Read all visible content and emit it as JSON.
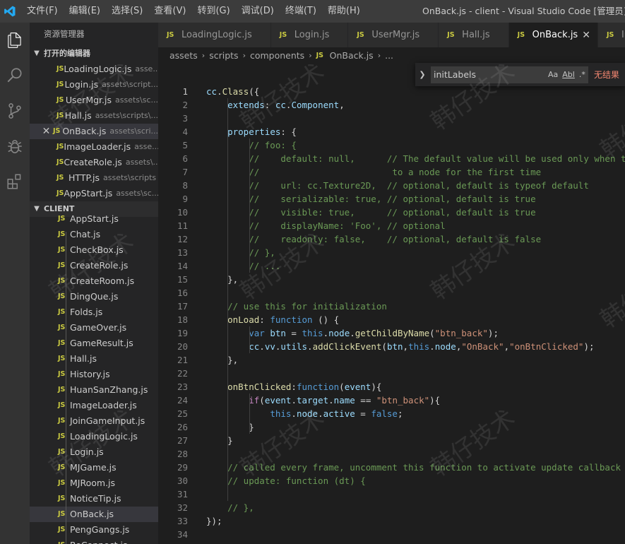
{
  "window": {
    "title": "OnBack.js - client - Visual Studio Code [管理员]",
    "menu": [
      "文件(F)",
      "编辑(E)",
      "选择(S)",
      "查看(V)",
      "转到(G)",
      "调试(D)",
      "终端(T)",
      "帮助(H)"
    ]
  },
  "sidebar": {
    "title": "资源管理器",
    "open_editors_label": "打开的编辑器",
    "open_editors": [
      {
        "name": "LoadingLogic.js",
        "path": "asse..."
      },
      {
        "name": "Login.js",
        "path": "assets\\script..."
      },
      {
        "name": "UserMgr.js",
        "path": "assets\\sc..."
      },
      {
        "name": "Hall.js",
        "path": "assets\\scripts\\..."
      },
      {
        "name": "OnBack.js",
        "path": "assets\\scri..."
      },
      {
        "name": "ImageLoader.js",
        "path": "asse..."
      },
      {
        "name": "CreateRole.js",
        "path": "assets\\..."
      },
      {
        "name": "HTTP.js",
        "path": "assets\\scripts"
      },
      {
        "name": "AppStart.js",
        "path": "assets\\sc..."
      }
    ],
    "client_label": "CLIENT",
    "client_files": [
      "AppStart.js",
      "Chat.js",
      "CheckBox.js",
      "CreateRole.js",
      "CreateRoom.js",
      "DingQue.js",
      "Folds.js",
      "GameOver.js",
      "GameResult.js",
      "Hall.js",
      "History.js",
      "HuanSanZhang.js",
      "ImageLoader.js",
      "JoinGameInput.js",
      "LoadingLogic.js",
      "Login.js",
      "MJGame.js",
      "MJRoom.js",
      "NoticeTip.js",
      "OnBack.js",
      "PengGangs.js",
      "ReConnect.js"
    ]
  },
  "tabs": [
    {
      "label": "LoadingLogic.js",
      "active": false
    },
    {
      "label": "Login.js",
      "active": false
    },
    {
      "label": "UserMgr.js",
      "active": false
    },
    {
      "label": "Hall.js",
      "active": false
    },
    {
      "label": "OnBack.js",
      "active": true
    },
    {
      "label": "ImageLoader.js",
      "active": false
    }
  ],
  "breadcrumb": [
    "assets",
    "scripts",
    "components",
    "OnBack.js",
    "..."
  ],
  "find": {
    "value": "initLabels",
    "opt_case": "Aa",
    "opt_word": "Abl",
    "opt_regex": ".*",
    "result": "无结果"
  },
  "editor": {
    "current_line": 1,
    "line_numbers": [
      "1",
      "2",
      "3",
      "4",
      "5",
      "6",
      "7",
      "8",
      "9",
      "10",
      "11",
      "12",
      "13",
      "14",
      "15",
      "16",
      "17",
      "18",
      "19",
      "20",
      "21",
      "22",
      "23",
      "24",
      "25",
      "26",
      "27",
      "28",
      "29",
      "30",
      "31",
      "32",
      "33",
      "34"
    ]
  },
  "watermark": "韩仔技术",
  "colors": {
    "keyword": "#569cd6",
    "property": "#9cdcfe",
    "function": "#dcdcaa",
    "string": "#ce9178",
    "comment": "#6a9955",
    "type": "#4ec9b0",
    "control": "#c586c0",
    "js_icon": "#cbcb41",
    "find_no_result": "#f48771"
  }
}
